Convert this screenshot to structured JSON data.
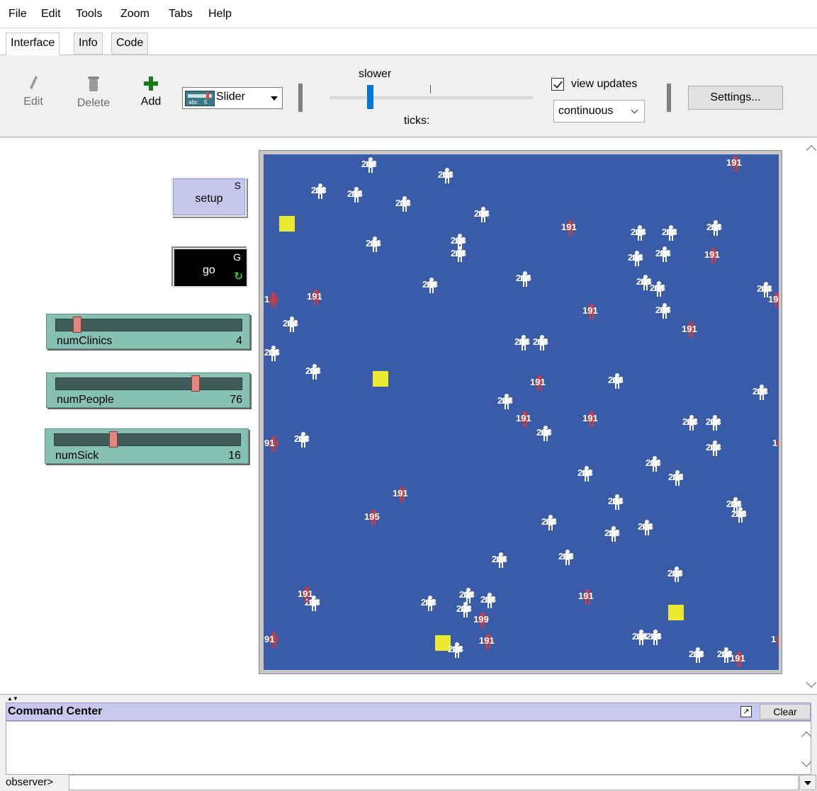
{
  "menu": [
    "File",
    "Edit",
    "Tools",
    "Zoom",
    "Tabs",
    "Help"
  ],
  "tabs": [
    "Interface",
    "Info",
    "Code"
  ],
  "toolbar": {
    "edit_label": "Edit",
    "delete_label": "Delete",
    "add_label": "Add",
    "widget_type": "Slider",
    "widget_icon_left": "abc",
    "widget_icon_right": "5",
    "speed_label": "slower",
    "ticks_label": "ticks:",
    "view_updates_label": "view updates",
    "view_updates_checked": true,
    "update_mode": "continuous",
    "settings_label": "Settings..."
  },
  "buttons": {
    "setup": {
      "label": "setup",
      "key": "S"
    },
    "go": {
      "label": "go",
      "key": "G",
      "forever": true
    }
  },
  "sliders": [
    {
      "name": "numClinics",
      "value": "4",
      "fraction": 0.1
    },
    {
      "name": "numPeople",
      "value": "76",
      "fraction": 0.76
    },
    {
      "name": "numSick",
      "value": "16",
      "fraction": 0.31
    }
  ],
  "world": {
    "background": "#3a5ba8",
    "clinic_color": "#ecea30",
    "healthy_color": "#ffffff",
    "sick_color": "#d23b3b"
  },
  "command_center": {
    "title": "Command Center",
    "clear_label": "Clear",
    "prompt": "observer>"
  }
}
